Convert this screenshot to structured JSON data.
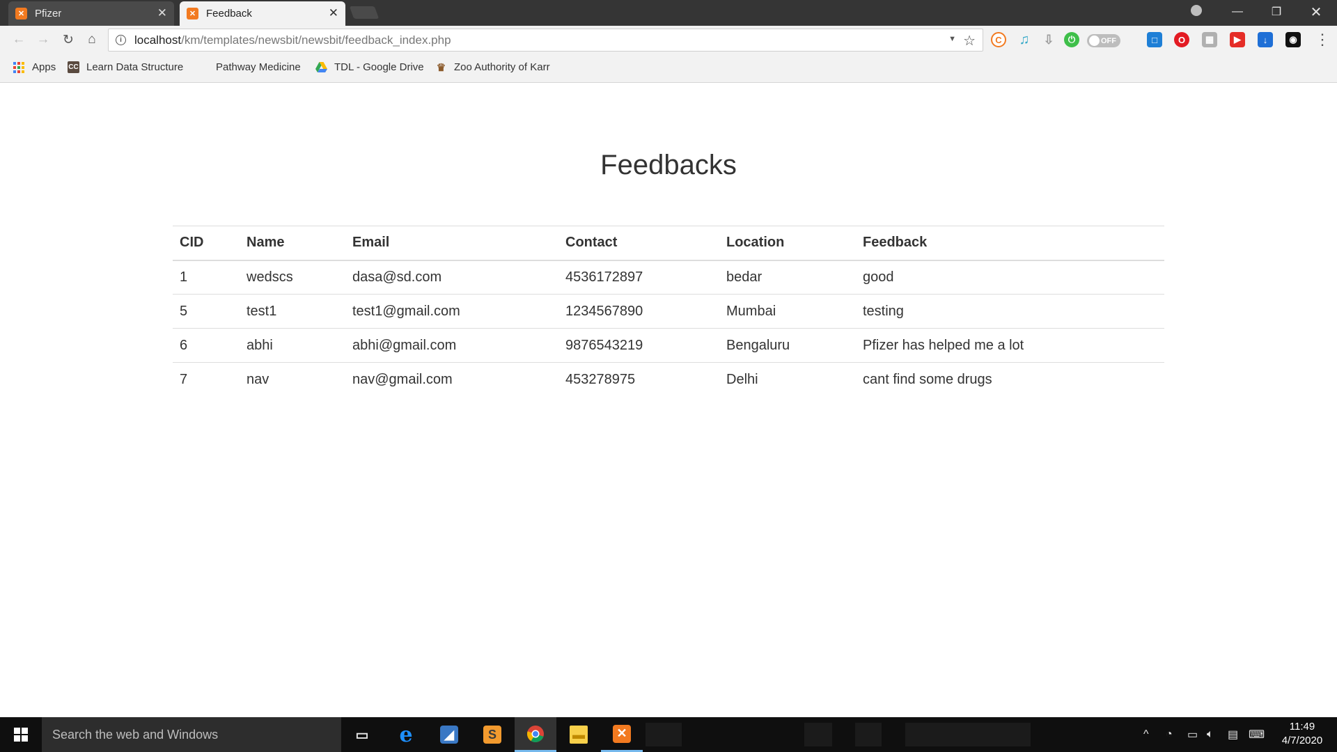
{
  "browser": {
    "tabs": [
      {
        "title": "Pfizer",
        "favicon": "xampp-icon"
      },
      {
        "title": "Feedback",
        "favicon": "xampp-icon"
      }
    ],
    "address": {
      "host": "localhost",
      "path": "/km/templates/newsbit/newsbit/feedback_index.php"
    },
    "extension_toggle_label": "OFF",
    "bookmarks": [
      {
        "label": "Apps",
        "icon": "apps-grid-icon"
      },
      {
        "label": "Learn Data Structures",
        "icon": "cc-icon"
      },
      {
        "label": "Pathway Medicine",
        "icon": "blank-icon"
      },
      {
        "label": "TDL - Google Drive",
        "icon": "google-drive-icon"
      },
      {
        "label": "Zoo Authority of Karr",
        "icon": "emblem-icon"
      }
    ]
  },
  "page": {
    "title": "Feedbacks",
    "table": {
      "headers": [
        "CID",
        "Name",
        "Email",
        "Contact",
        "Location",
        "Feedback"
      ],
      "rows": [
        [
          "1",
          "wedscs",
          "dasa@sd.com",
          "4536172897",
          "bedar",
          "good"
        ],
        [
          "5",
          "test1",
          "test1@gmail.com",
          "1234567890",
          "Mumbai",
          "testing"
        ],
        [
          "6",
          "abhi",
          "abhi@gmail.com",
          "9876543219",
          "Bengaluru",
          "Pfizer has helped me a lot"
        ],
        [
          "7",
          "nav",
          "nav@gmail.com",
          "453278975",
          "Delhi",
          "cant find some drugs"
        ]
      ]
    }
  },
  "taskbar": {
    "search_placeholder": "Search the web and Windows",
    "time": "11:49",
    "date": "4/7/2020"
  },
  "colors": {
    "tab_strip": "#353535",
    "toolbar": "#f2f2f2",
    "taskbar": "#0f0f0f",
    "xampp_orange": "#f27a20"
  }
}
